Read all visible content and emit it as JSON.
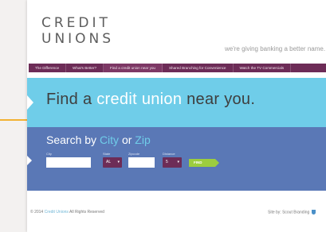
{
  "logo": {
    "line1": "CREDIT",
    "line2": "UNIONS"
  },
  "tagline": "we're giving banking a better name.",
  "nav": {
    "items": [
      "The Difference",
      "What's Better?",
      "Find a credit union near you",
      "Shared Branching for Convenience",
      "Watch the TV Commercials"
    ]
  },
  "hero": {
    "pre": "Find a ",
    "highlight": "credit union",
    "post": " near you."
  },
  "search": {
    "heading_pre": "Search by ",
    "city": "City",
    "or": " or ",
    "zip": "Zip",
    "labels": {
      "city": "City",
      "state": "State",
      "zipcode": "Zipcode",
      "distance": "Distance"
    },
    "state_value": "AL",
    "distance_value": "5",
    "find_label": "FIND"
  },
  "footer": {
    "copyright_pre": "© 2014 ",
    "copyright_link": "Credit Unions",
    "copyright_post": " All Rights Reserved",
    "credit": "Site by: Scout Branding"
  },
  "colors": {
    "nav": "#6d2c57",
    "hero": "#6fcde9",
    "search": "#5a78b6",
    "find": "#9ccd3e",
    "accent_line": "#f2b233"
  },
  "icons": [
    "chevron-down-icon",
    "arrow-marker-icon",
    "shield-icon"
  ]
}
